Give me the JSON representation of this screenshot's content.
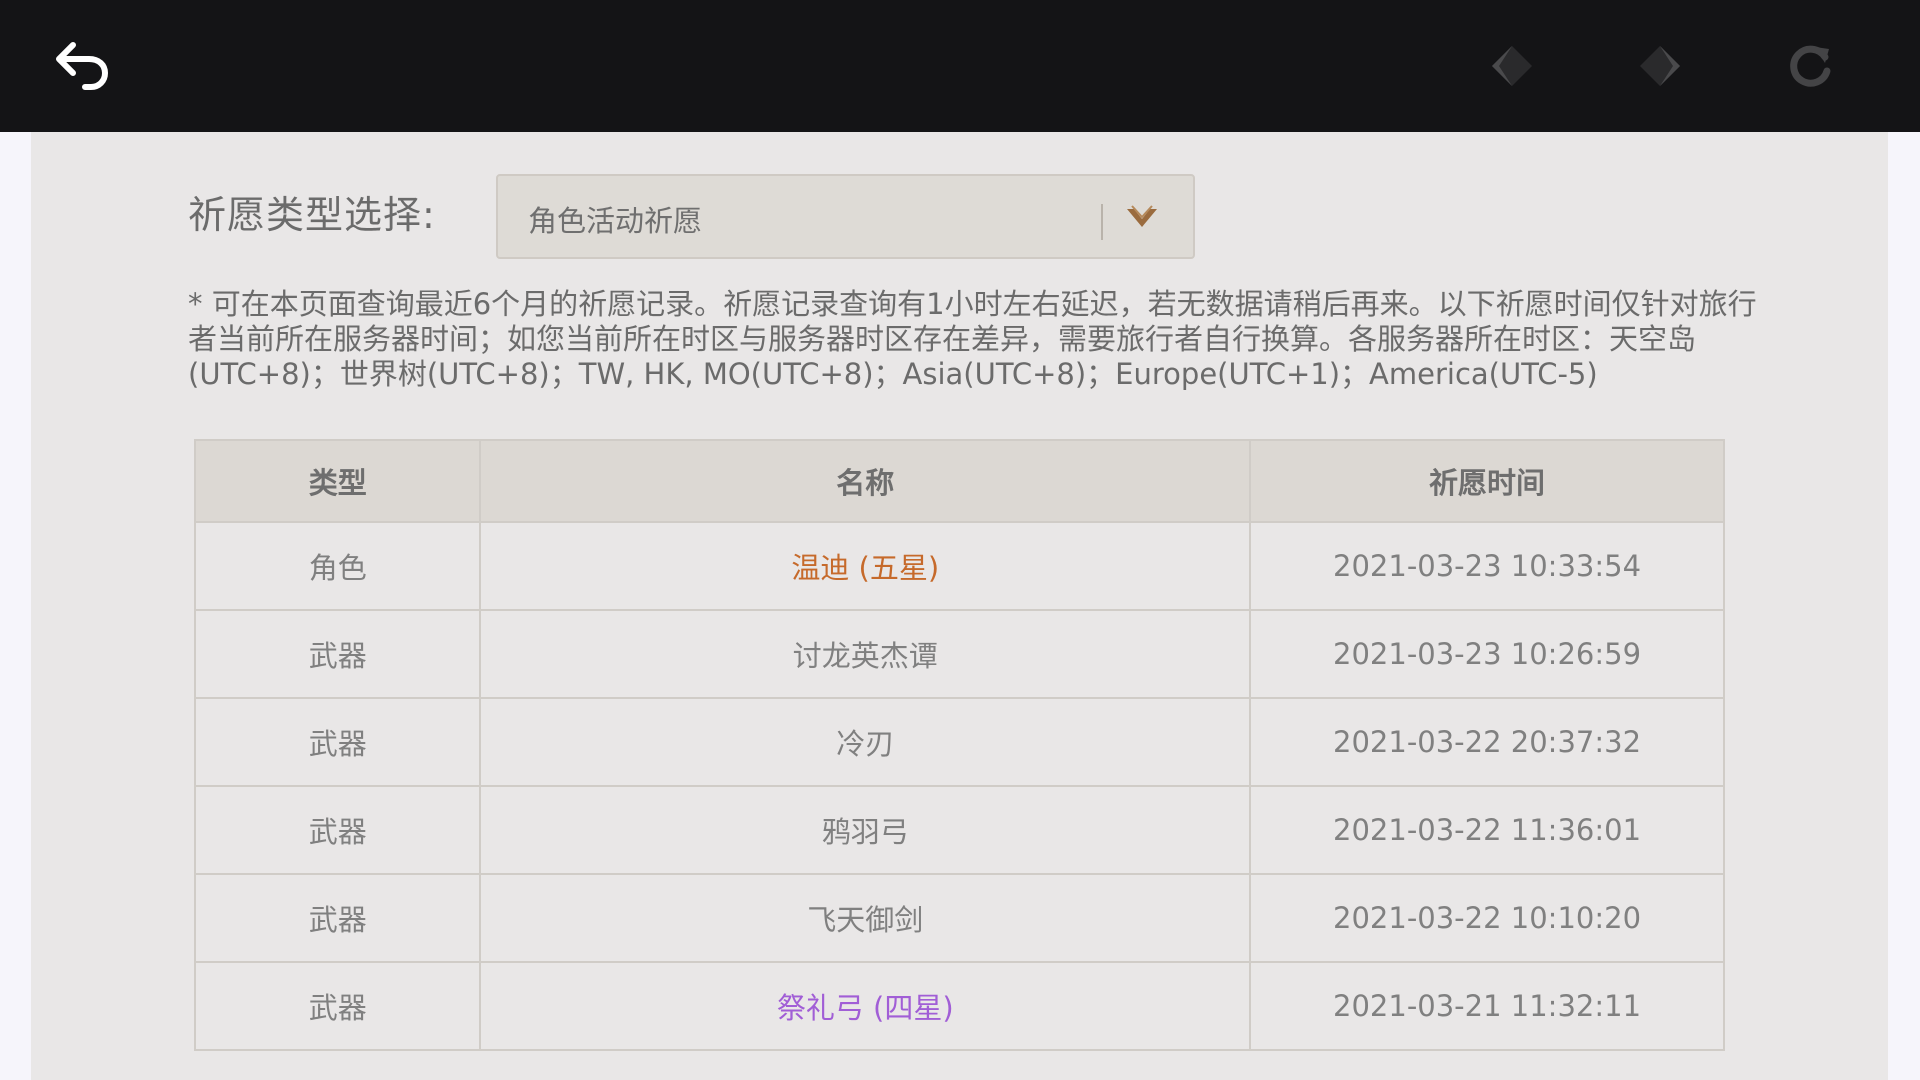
{
  "colors": {
    "topbar": "#141416",
    "five_star": "#c66a2b",
    "four_star": "#a15ed6",
    "default_text": "#808080"
  },
  "topbar": {
    "back_icon": "back-arrow-icon",
    "prev_icon": "prev-diamond-icon",
    "next_icon": "next-diamond-icon",
    "refresh_icon": "refresh-icon"
  },
  "filter": {
    "label": "祈愿类型选择:",
    "selected": "角色活动祈愿"
  },
  "notice": "* 可在本页面查询最近6个月的祈愿记录。祈愿记录查询有1小时左右延迟，若无数据请稍后再来。以下祈愿时间仅针对旅行者当前所在服务器时间；如您当前所在时区与服务器时区存在差异，需要旅行者自行换算。各服务器所在时区：天空岛(UTC+8)；世界树(UTC+8)；TW, HK, MO(UTC+8)；Asia(UTC+8)；Europe(UTC+1)；America(UTC-5)",
  "table": {
    "headers": [
      "类型",
      "名称",
      "祈愿时间"
    ],
    "rows": [
      {
        "type": "角色",
        "name": "温迪 (五星)",
        "time": "2021-03-23 10:33:54",
        "rarity": "five"
      },
      {
        "type": "武器",
        "name": "讨龙英杰谭",
        "time": "2021-03-23 10:26:59",
        "rarity": "three"
      },
      {
        "type": "武器",
        "name": "冷刃",
        "time": "2021-03-22 20:37:32",
        "rarity": "three"
      },
      {
        "type": "武器",
        "name": "鸦羽弓",
        "time": "2021-03-22 11:36:01",
        "rarity": "three"
      },
      {
        "type": "武器",
        "name": "飞天御剑",
        "time": "2021-03-22 10:10:20",
        "rarity": "three"
      },
      {
        "type": "武器",
        "name": "祭礼弓 (四星)",
        "time": "2021-03-21 11:32:11",
        "rarity": "four"
      }
    ]
  }
}
